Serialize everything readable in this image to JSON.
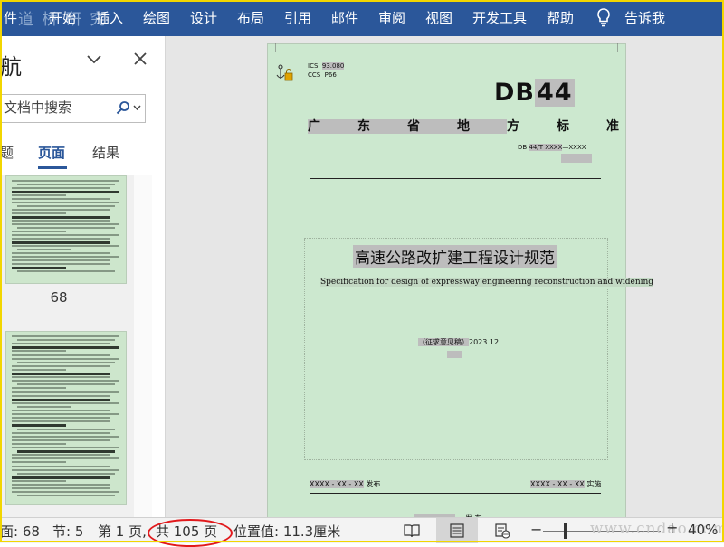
{
  "ribbon": {
    "tabs": [
      "件",
      "开始",
      "插入",
      "绘图",
      "设计",
      "布局",
      "引用",
      "邮件",
      "审阅",
      "视图",
      "开发工具",
      "帮助",
      "告诉我"
    ],
    "watermark": "道 桥 研 究"
  },
  "nav_pane": {
    "title": "航",
    "search_placeholder": "文档中搜索",
    "tabs": [
      {
        "label": "题",
        "active": false
      },
      {
        "label": "页面",
        "active": true
      },
      {
        "label": "结果",
        "active": false
      }
    ],
    "thumbnails": [
      {
        "page": "68"
      },
      {
        "page": ""
      }
    ]
  },
  "document": {
    "ics": "ICS",
    "ics_code": "93.080",
    "ccs": "CCS",
    "ccs_code": "P66",
    "db_prefix": "DB",
    "db_number": "44",
    "province": [
      "广",
      "东",
      "省",
      "地",
      "方",
      "标",
      "准"
    ],
    "std_code_prefix": "DB",
    "std_code_hl": "44/T XXXX",
    "std_code_suffix": "—XXXX",
    "title_cn": "高速公路改扩建工程设计规范",
    "title_en": "Specification for design of expressway engineering reconstruction and widening",
    "draft_label": "（征求意见稿）",
    "draft_date": "2023.12",
    "issue_date": "XXXX - XX - XX",
    "issue_label": "发布",
    "impl_date": "XXXX - XX - XX",
    "impl_label": "实施",
    "publish_suffix": "发 布"
  },
  "status_bar": {
    "page_field": "面: 68",
    "section": "节: 5",
    "page_of": "第 1 页,",
    "total_pages": "共 105 页",
    "position": "位置值: 11.3厘米",
    "zoom": "40%",
    "watermark": "www.cndao.com"
  },
  "colors": {
    "ribbon": "#2b579a",
    "page_bg": "#cce8cf",
    "highlight": "#bdbdbd",
    "annotation_circle": "#e1191c",
    "frame_border": "#f2d600"
  }
}
